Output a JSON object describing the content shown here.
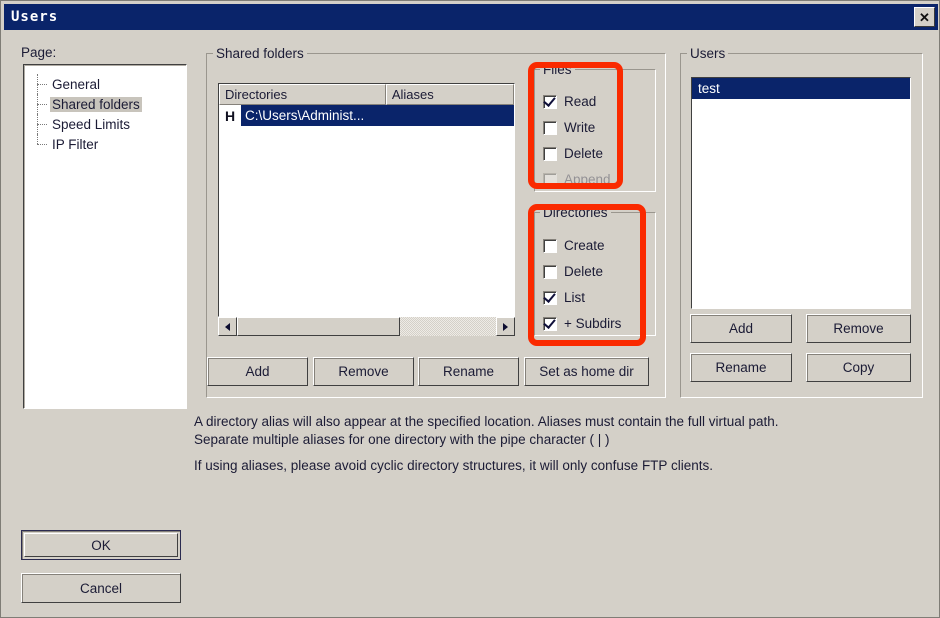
{
  "window": {
    "title": "Users",
    "close_label": "✕"
  },
  "sidebar": {
    "label": "Page:",
    "items": [
      {
        "label": "General",
        "selected": false
      },
      {
        "label": "Shared folders",
        "selected": true
      },
      {
        "label": "Speed Limits",
        "selected": false
      },
      {
        "label": "IP Filter",
        "selected": false
      }
    ]
  },
  "shared_folders": {
    "group_title": "Shared folders",
    "columns": [
      "Directories",
      "Aliases"
    ],
    "rows": [
      {
        "flag": "H",
        "directory": "C:\\Users\\Administ...",
        "alias": "",
        "selected": true
      }
    ],
    "buttons": [
      "Add",
      "Remove",
      "Rename",
      "Set as home dir"
    ]
  },
  "files_permissions": {
    "group_title": "Files",
    "items": [
      {
        "label": "Read",
        "checked": true
      },
      {
        "label": "Write",
        "checked": false
      },
      {
        "label": "Delete",
        "checked": false
      },
      {
        "label": "Append",
        "checked": false
      }
    ]
  },
  "directories_permissions": {
    "group_title": "Directories",
    "items": [
      {
        "label": "Create",
        "checked": false
      },
      {
        "label": "Delete",
        "checked": false
      },
      {
        "label": "List",
        "checked": true
      },
      {
        "label": "+ Subdirs",
        "checked": true
      }
    ]
  },
  "users": {
    "group_title": "Users",
    "list": [
      {
        "label": "test",
        "selected": true
      }
    ],
    "buttons": [
      "Add",
      "Remove",
      "Rename",
      "Copy"
    ]
  },
  "description": {
    "paragraph1": "A directory alias will also appear at the specified location. Aliases must contain the full virtual path. Separate multiple aliases for one directory with the pipe character ( | )",
    "paragraph2": "If using aliases, please avoid cyclic directory structures, it will only confuse FTP clients."
  },
  "footer": {
    "ok_label": "OK",
    "cancel_label": "Cancel"
  },
  "annotations": {
    "highlight_color": "#fa2a00",
    "count": 2
  }
}
